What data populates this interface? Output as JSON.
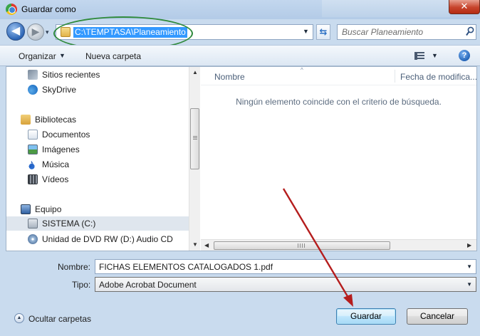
{
  "window": {
    "title": "Guardar como",
    "close_glyph": "✕"
  },
  "nav": {
    "back_glyph": "◀",
    "forward_glyph": "▶",
    "history_glyph": "▾",
    "refresh_glyph": "⇆"
  },
  "address": {
    "path": "C:\\TEMPTASA\\Planeamiento",
    "dropdown_glyph": "▼"
  },
  "search": {
    "placeholder": "Buscar Planeamiento"
  },
  "toolbar": {
    "organize_label": "Organizar",
    "organize_caret": "▼",
    "new_folder_label": "Nueva carpeta",
    "view_caret": "▼",
    "help_glyph": "?"
  },
  "sidebar": {
    "items": [
      {
        "label": "Sitios recientes",
        "icon": "recent-places-icon"
      },
      {
        "label": "SkyDrive",
        "icon": "skydrive-icon"
      },
      {
        "label": "Bibliotecas",
        "icon": "libraries-icon"
      },
      {
        "label": "Documentos",
        "icon": "documents-icon"
      },
      {
        "label": "Imágenes",
        "icon": "pictures-icon"
      },
      {
        "label": "Música",
        "icon": "music-icon"
      },
      {
        "label": "Vídeos",
        "icon": "videos-icon"
      },
      {
        "label": "Equipo",
        "icon": "computer-icon"
      },
      {
        "label": "SISTEMA (C:)",
        "icon": "drive-icon",
        "selected": true
      },
      {
        "label": "Unidad de DVD RW (D:) Audio CD",
        "icon": "dvd-drive-icon"
      }
    ]
  },
  "file_list": {
    "columns": [
      "Nombre",
      "Fecha de modifica..."
    ],
    "sort_glyph": "^",
    "empty_message": "Ningún elemento coincide con el criterio de búsqueda."
  },
  "scroll": {
    "up": "▲",
    "down": "▼",
    "left": "◀",
    "right": "▶"
  },
  "form": {
    "filename_label": "Nombre:",
    "filename_value": "FICHAS ELEMENTOS CATALOGADOS 1.pdf",
    "type_label": "Tipo:",
    "type_value": "Adobe Acrobat Document",
    "combo_arrow": "▼"
  },
  "footer": {
    "hide_folders_label": "Ocultar carpetas",
    "hide_folders_glyph": "▲",
    "save_label": "Guardar",
    "cancel_label": "Cancelar"
  },
  "colors": {
    "annotation_ellipse": "#2f8a3c",
    "annotation_arrow": "#b51d1d",
    "selection": "#3399ff",
    "frame": "#c9dbee"
  }
}
